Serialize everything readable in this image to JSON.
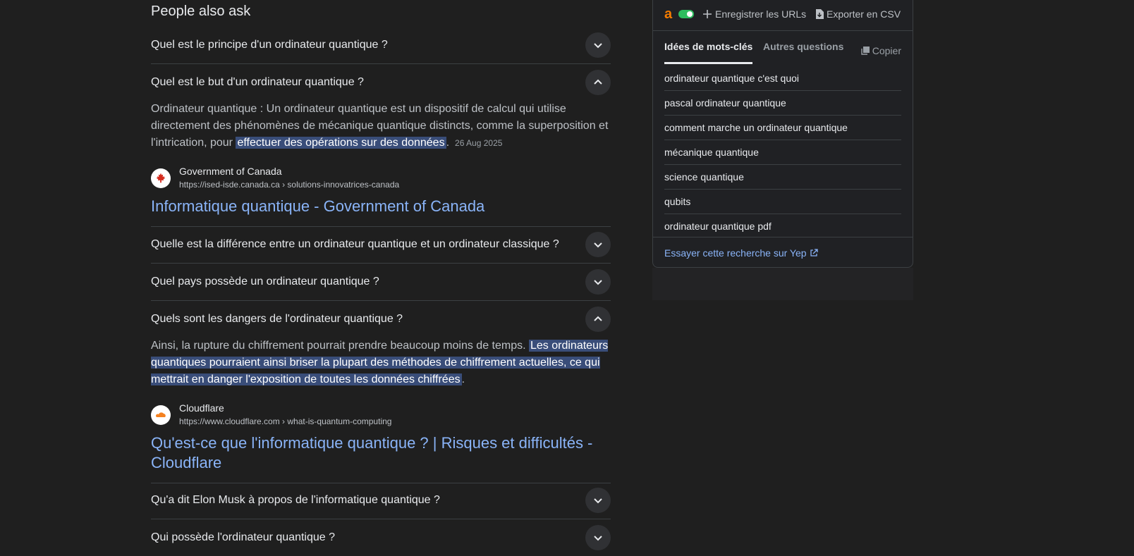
{
  "paa": {
    "title": "People also ask",
    "questions": [
      {
        "q": "Quel est le principe d'un ordinateur quantique ?"
      },
      {
        "q": "Quel est le but d'un ordinateur quantique ?",
        "answer_pre": "Ordinateur quantique : Un ordinateur quantique est un dispositif de calcul qui utilise directement des phénomènes de mécanique quantique distincts, comme la superposition et l'intrication, pour ",
        "answer_hl": "effectuer des opérations sur des données",
        "answer_post": ".",
        "date": "26 Aug 2025",
        "source_name": "Government of Canada",
        "source_url": "https://ised-isde.canada.ca › solutions-innovatrices-canada",
        "result_title": "Informatique quantique - Government of Canada"
      },
      {
        "q": "Quelle est la différence entre un ordinateur quantique et un ordinateur classique ?"
      },
      {
        "q": "Quel pays possède un ordinateur quantique ?"
      },
      {
        "q": "Quels sont les dangers de l'ordinateur quantique ?",
        "answer_pre": "Ainsi, la rupture du chiffrement pourrait prendre beaucoup moins de temps. ",
        "answer_hl": "Les ordinateurs quantiques pourraient ainsi briser la plupart des méthodes de chiffrement actuelles, ce qui mettrait en danger l'exposition de toutes les données chiffrées",
        "answer_post": ".",
        "source_name": "Cloudflare",
        "source_url": "https://www.cloudflare.com › what-is-quantum-computing",
        "result_title": "Qu'est-ce que l'informatique quantique ? | Risques et difficultés - Cloudflare"
      },
      {
        "q": "Qu'a dit Elon Musk à propos de l'informatique quantique ?"
      },
      {
        "q": "Qui possède l'ordinateur quantique ?"
      }
    ]
  },
  "panel": {
    "logo": "a",
    "save_urls": "Enregistrer les URLs",
    "export_csv": "Exporter en CSV",
    "tab_keywords": "Idées de mots-clés",
    "tab_questions": "Autres questions",
    "copy": "Copier",
    "keywords": [
      "ordinateur quantique c'est quoi",
      "pascal ordinateur quantique",
      "comment marche un ordinateur quantique",
      "mécanique quantique",
      "science quantique",
      "qubits",
      "ordinateur quantique pdf"
    ],
    "yep_link": "Essayer cette recherche sur Yep"
  },
  "colors": {
    "background": "#1f1f1f",
    "link": "#8ab4f8",
    "highlight": "#394d79",
    "toggle_on": "#2ebd5f",
    "logo": "#f57c00"
  }
}
